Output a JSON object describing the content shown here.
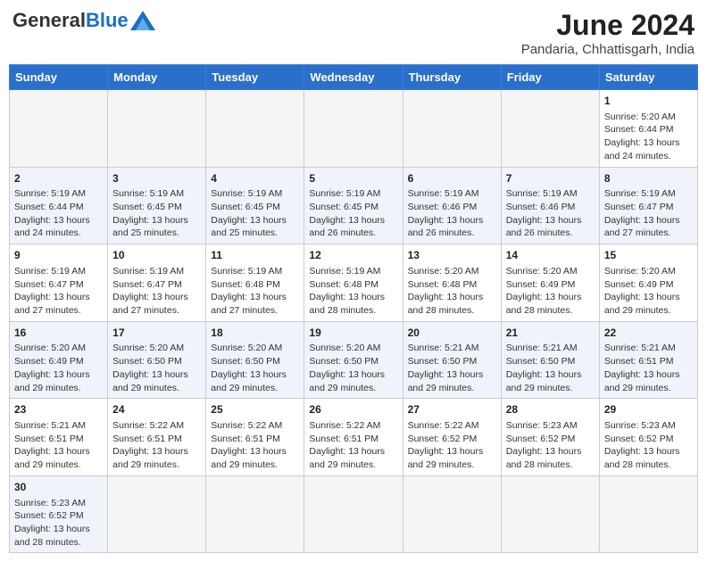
{
  "header": {
    "logo_general": "General",
    "logo_blue": "Blue",
    "month_title": "June 2024",
    "location": "Pandaria, Chhattisgarh, India"
  },
  "weekdays": [
    "Sunday",
    "Monday",
    "Tuesday",
    "Wednesday",
    "Thursday",
    "Friday",
    "Saturday"
  ],
  "days": {
    "1": {
      "sunrise": "5:20 AM",
      "sunset": "6:44 PM",
      "daylight": "13 hours and 24 minutes."
    },
    "2": {
      "sunrise": "5:19 AM",
      "sunset": "6:44 PM",
      "daylight": "13 hours and 24 minutes."
    },
    "3": {
      "sunrise": "5:19 AM",
      "sunset": "6:45 PM",
      "daylight": "13 hours and 25 minutes."
    },
    "4": {
      "sunrise": "5:19 AM",
      "sunset": "6:45 PM",
      "daylight": "13 hours and 25 minutes."
    },
    "5": {
      "sunrise": "5:19 AM",
      "sunset": "6:45 PM",
      "daylight": "13 hours and 26 minutes."
    },
    "6": {
      "sunrise": "5:19 AM",
      "sunset": "6:46 PM",
      "daylight": "13 hours and 26 minutes."
    },
    "7": {
      "sunrise": "5:19 AM",
      "sunset": "6:46 PM",
      "daylight": "13 hours and 26 minutes."
    },
    "8": {
      "sunrise": "5:19 AM",
      "sunset": "6:47 PM",
      "daylight": "13 hours and 27 minutes."
    },
    "9": {
      "sunrise": "5:19 AM",
      "sunset": "6:47 PM",
      "daylight": "13 hours and 27 minutes."
    },
    "10": {
      "sunrise": "5:19 AM",
      "sunset": "6:47 PM",
      "daylight": "13 hours and 27 minutes."
    },
    "11": {
      "sunrise": "5:19 AM",
      "sunset": "6:48 PM",
      "daylight": "13 hours and 27 minutes."
    },
    "12": {
      "sunrise": "5:19 AM",
      "sunset": "6:48 PM",
      "daylight": "13 hours and 28 minutes."
    },
    "13": {
      "sunrise": "5:20 AM",
      "sunset": "6:48 PM",
      "daylight": "13 hours and 28 minutes."
    },
    "14": {
      "sunrise": "5:20 AM",
      "sunset": "6:49 PM",
      "daylight": "13 hours and 28 minutes."
    },
    "15": {
      "sunrise": "5:20 AM",
      "sunset": "6:49 PM",
      "daylight": "13 hours and 29 minutes."
    },
    "16": {
      "sunrise": "5:20 AM",
      "sunset": "6:49 PM",
      "daylight": "13 hours and 29 minutes."
    },
    "17": {
      "sunrise": "5:20 AM",
      "sunset": "6:50 PM",
      "daylight": "13 hours and 29 minutes."
    },
    "18": {
      "sunrise": "5:20 AM",
      "sunset": "6:50 PM",
      "daylight": "13 hours and 29 minutes."
    },
    "19": {
      "sunrise": "5:20 AM",
      "sunset": "6:50 PM",
      "daylight": "13 hours and 29 minutes."
    },
    "20": {
      "sunrise": "5:21 AM",
      "sunset": "6:50 PM",
      "daylight": "13 hours and 29 minutes."
    },
    "21": {
      "sunrise": "5:21 AM",
      "sunset": "6:50 PM",
      "daylight": "13 hours and 29 minutes."
    },
    "22": {
      "sunrise": "5:21 AM",
      "sunset": "6:51 PM",
      "daylight": "13 hours and 29 minutes."
    },
    "23": {
      "sunrise": "5:21 AM",
      "sunset": "6:51 PM",
      "daylight": "13 hours and 29 minutes."
    },
    "24": {
      "sunrise": "5:22 AM",
      "sunset": "6:51 PM",
      "daylight": "13 hours and 29 minutes."
    },
    "25": {
      "sunrise": "5:22 AM",
      "sunset": "6:51 PM",
      "daylight": "13 hours and 29 minutes."
    },
    "26": {
      "sunrise": "5:22 AM",
      "sunset": "6:51 PM",
      "daylight": "13 hours and 29 minutes."
    },
    "27": {
      "sunrise": "5:22 AM",
      "sunset": "6:52 PM",
      "daylight": "13 hours and 29 minutes."
    },
    "28": {
      "sunrise": "5:23 AM",
      "sunset": "6:52 PM",
      "daylight": "13 hours and 28 minutes."
    },
    "29": {
      "sunrise": "5:23 AM",
      "sunset": "6:52 PM",
      "daylight": "13 hours and 28 minutes."
    },
    "30": {
      "sunrise": "5:23 AM",
      "sunset": "6:52 PM",
      "daylight": "13 hours and 28 minutes."
    }
  }
}
